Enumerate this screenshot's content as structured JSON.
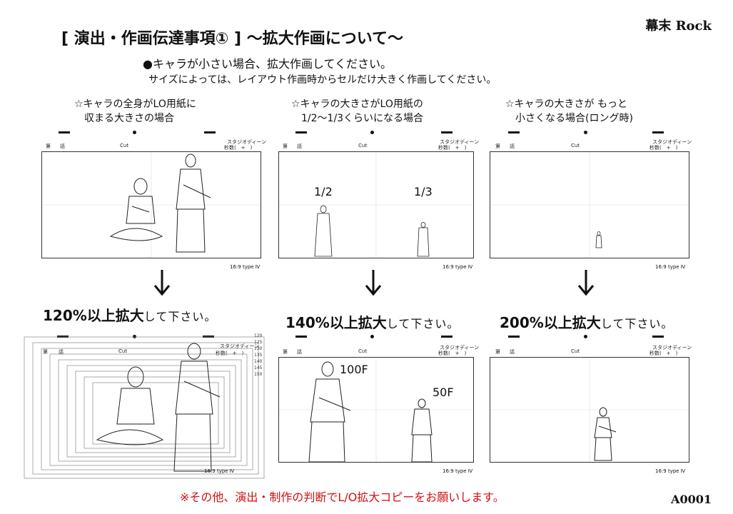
{
  "header": {
    "title": "[ 演出・作画伝達事項① ] 〜拡大作画について〜",
    "brand": "幕末 Rock",
    "intro_line1": "●キャラが小さい場合、拡大作画してください。",
    "intro_line2": "サイズによっては、レイアウト作画時からセルだけ大きく作画してください。"
  },
  "captions": [
    "☆キャラの全身がLO用紙に\n　収まる大きさの場合",
    "☆キャラの大きさがLO用紙の\n　1/2〜1/3くらいになる場合",
    "☆キャラの大きさが もっと\n　小さくなる場合(ロング時)"
  ],
  "sheet": {
    "no_label": "第",
    "episode_label": "話",
    "cut_label": "Cut",
    "studio_label": "スタジオディーン",
    "seconds_label": "秒数(　+　)",
    "type_label": "16:9 type Ⅳ"
  },
  "fractions": {
    "half": "1/2",
    "third": "1/3"
  },
  "frames": {
    "f100": "100F",
    "f50": "50F"
  },
  "scale_values": [
    "120",
    "125",
    "130",
    "135",
    "140",
    "145",
    "150"
  ],
  "instructions": [
    {
      "value": "120%以上拡大",
      "suffix": "して下さい。"
    },
    {
      "value": "140%以上拡大",
      "suffix": "して下さい。"
    },
    {
      "value": "200%以上拡大",
      "suffix": "して下さい。"
    }
  ],
  "footer": "※その他、演出・制作の判断でL/O拡大コピーをお願いします。",
  "page_id": "A0001"
}
